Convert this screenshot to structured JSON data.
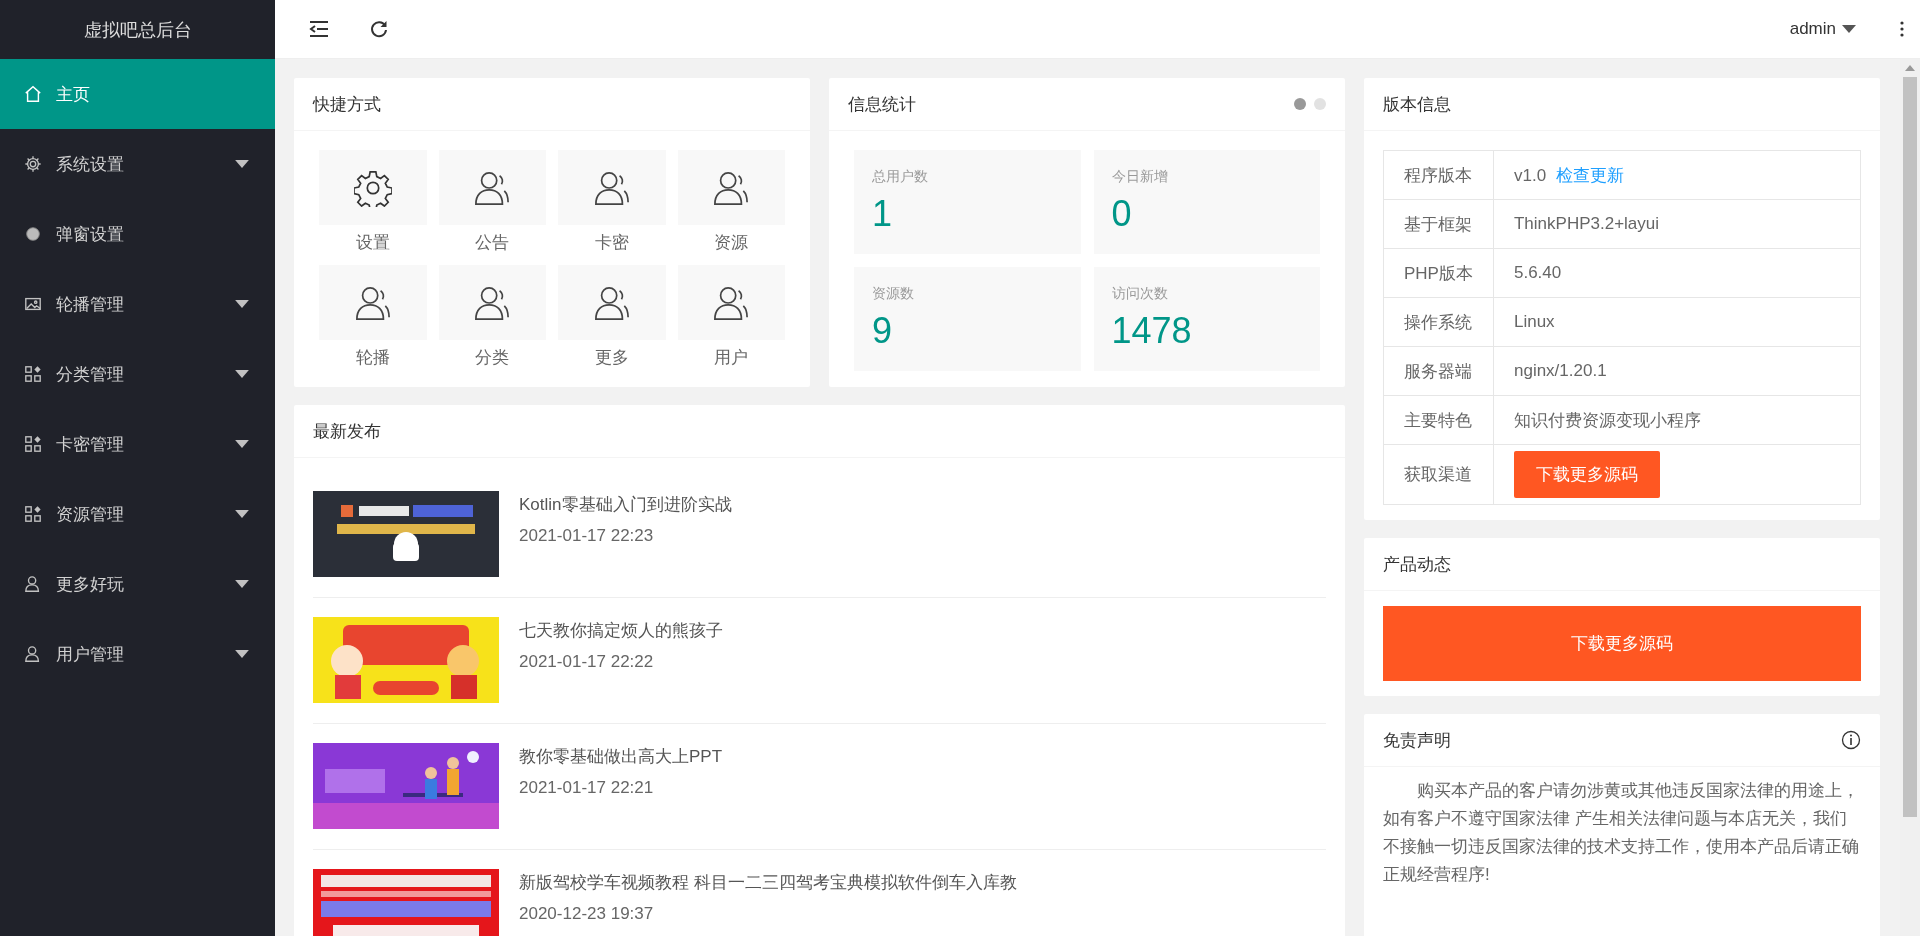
{
  "sidebar": {
    "title": "虚拟吧总后台",
    "items": [
      {
        "label": "主页",
        "kind": "link",
        "selected": true
      },
      {
        "label": "系统设置",
        "kind": "group",
        "selected": false
      },
      {
        "label": "弹窗设置",
        "kind": "link",
        "selected": false
      },
      {
        "label": "轮播管理",
        "kind": "group",
        "selected": false
      },
      {
        "label": "分类管理",
        "kind": "group",
        "selected": false
      },
      {
        "label": "卡密管理",
        "kind": "group",
        "selected": false
      },
      {
        "label": "资源管理",
        "kind": "group",
        "selected": false
      },
      {
        "label": "更多好玩",
        "kind": "group",
        "selected": false
      },
      {
        "label": "用户管理",
        "kind": "group",
        "selected": false
      }
    ]
  },
  "header": {
    "user": "admin"
  },
  "shortcuts": {
    "title": "快捷方式",
    "items": [
      "设置",
      "公告",
      "卡密",
      "资源",
      "轮播",
      "分类",
      "更多",
      "用户"
    ]
  },
  "stats": {
    "title": "信息统计",
    "indicators": [
      {
        "selected": true
      },
      {
        "selected": false
      }
    ],
    "items": [
      {
        "label": "总用户数",
        "value": "1"
      },
      {
        "label": "今日新增",
        "value": "0"
      },
      {
        "label": "资源数",
        "value": "9"
      },
      {
        "label": "访问次数",
        "value": "1478"
      }
    ]
  },
  "latest": {
    "title": "最新发布",
    "items": [
      {
        "title": "Kotlin零基础入门到进阶实战",
        "date": "2021-01-17 22:23",
        "kind": "picture"
      },
      {
        "title": "七天教你搞定烦人的熊孩子",
        "date": "2021-01-17 22:22",
        "kind": "picture"
      },
      {
        "title": "教你零基础做出高大上PPT",
        "date": "2021-01-17 22:21",
        "kind": "picture"
      },
      {
        "title": "新版驾校学车视频教程 科目一二三四驾考宝典模拟软件倒车入库教",
        "date": "2020-12-23 19:37",
        "kind": "picture"
      }
    ]
  },
  "version": {
    "title": "版本信息",
    "rows": [
      {
        "label": "程序版本",
        "kind": "text_link",
        "value": "v1.0",
        "link": "检查更新"
      },
      {
        "label": "基于框架",
        "kind": "text",
        "value": "ThinkPHP3.2+layui"
      },
      {
        "label": "PHP版本",
        "kind": "text",
        "value": "5.6.40"
      },
      {
        "label": "操作系统",
        "kind": "text",
        "value": "Linux"
      },
      {
        "label": "服务器端",
        "kind": "text",
        "value": "nginx/1.20.1"
      },
      {
        "label": "主要特色",
        "kind": "text",
        "value": "知识付费资源变现小程序"
      },
      {
        "label": "获取渠道",
        "kind": "button",
        "value": "下载更多源码"
      }
    ]
  },
  "product": {
    "title": "产品动态",
    "button": "下载更多源码"
  },
  "disclaimer": {
    "title": "免责声明",
    "text": "购买本产品的客户请勿涉黄或其他违反国家法律的用途上，如有客户不遵守国家法律 产生相关法律问题与本店无关，我们不接触一切违反国家法律的技术支持工作，使用本产品后请正确正规经营程序!"
  }
}
